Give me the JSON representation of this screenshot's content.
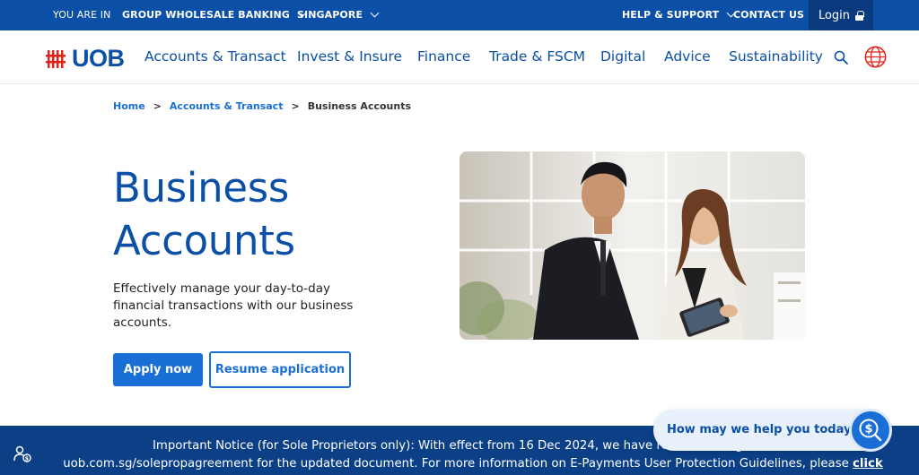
{
  "topbar": {
    "you_are_in": "YOU ARE IN",
    "segment": "GROUP WHOLESALE BANKING",
    "country": "SINGAPORE",
    "help": "HELP & SUPPORT",
    "contact": "CONTACT US",
    "login": "Login"
  },
  "brand": {
    "name": "UOB",
    "color": "#0b4fa6",
    "accent": "#e2231a"
  },
  "nav": {
    "items": [
      "Accounts & Transact",
      "Invest & Insure",
      "Finance",
      "Trade & FSCM",
      "Digital",
      "Advice",
      "Sustainability"
    ],
    "search_icon": "search-icon",
    "globe_icon": "globe-icon"
  },
  "breadcrumb": {
    "home": "Home",
    "parent": "Accounts & Transact",
    "current": "Business Accounts",
    "separator": ">"
  },
  "hero": {
    "title_line1": "Business",
    "title_line2": "Accounts",
    "description": "Effectively manage your day-to-day financial transactions with our business accounts.",
    "apply_label": "Apply now",
    "resume_label": "Resume application"
  },
  "notice": {
    "text": "Important Notice (for Sole Proprietors only): With effect from 16 Dec 2024, we have revised the Agreement",
    "text2": "uob.com.sg/solepropagreement for the updated document. For more information on E-Payments User Protection Guidelines, please",
    "link": "click here",
    "end": "."
  },
  "chat": {
    "prompt": "How may we help you today?"
  }
}
